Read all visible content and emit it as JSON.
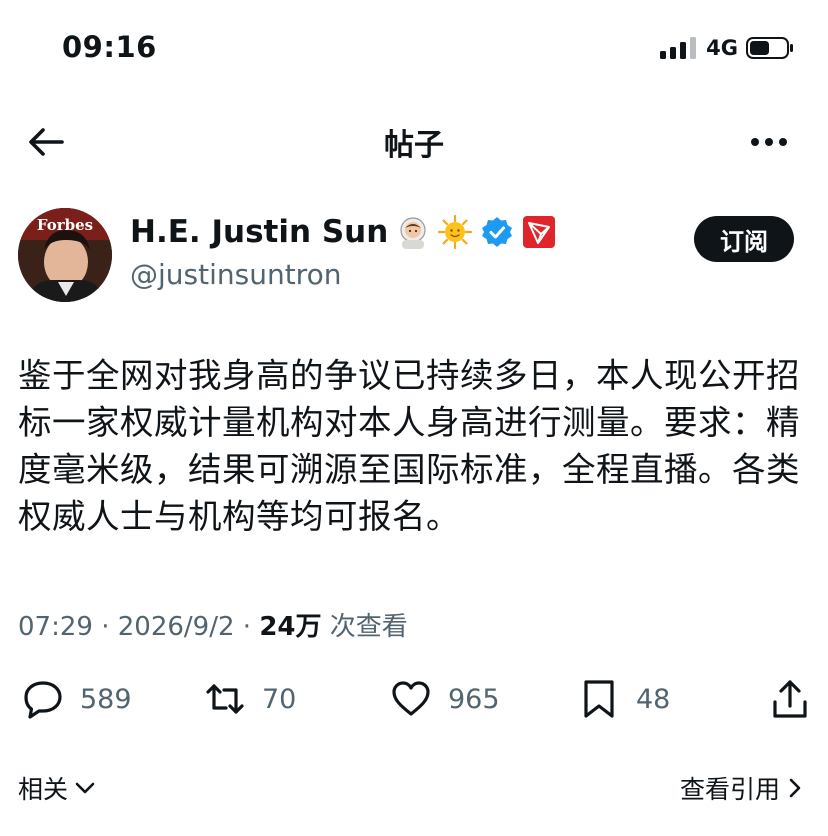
{
  "status_bar": {
    "time": "09:16",
    "network": "4G"
  },
  "nav": {
    "title": "帖子"
  },
  "author": {
    "avatar_text": "Forbes",
    "name": "H.E. Justin Sun",
    "handle": "@justinsuntron",
    "emoji_icons": [
      "astronaut-emoji-icon",
      "sun-emoji-icon",
      "verified-badge-icon",
      "tron-logo-icon"
    ],
    "subscribe_label": "订阅"
  },
  "post": {
    "text": "鉴于全网对我身高的争议已持续多日，本人现公开招标一家权威计量机构对本人身高进行测量。要求：精度毫米级，结果可溯源至国际标准，全程直播。各类权威人士与机构等均可报名。"
  },
  "meta": {
    "time": "07:29",
    "date": "2026/9/2",
    "views": "24万",
    "views_label": "次查看"
  },
  "actions": {
    "replies": "589",
    "reposts": "70",
    "likes": "965",
    "bookmarks": "48"
  },
  "footer": {
    "related_label": "相关",
    "quotes_label": "查看引用"
  },
  "colors": {
    "text": "#0f1419",
    "secondary": "#536471",
    "verified": "#1d9bf0",
    "tron": "#e0242c"
  }
}
